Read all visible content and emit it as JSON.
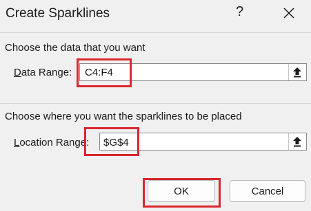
{
  "dialog": {
    "title": "Create Sparklines",
    "help_label": "?"
  },
  "data_section": {
    "heading": "Choose the data that you want",
    "field_label_underlined": "D",
    "field_label_rest": "ata Range:",
    "value": "C4:F4"
  },
  "location_section": {
    "heading": "Choose where you want the sparklines to be placed",
    "field_label_underlined": "L",
    "field_label_rest": "ocation Range:",
    "value": "$G$4"
  },
  "buttons": {
    "ok_label": "OK",
    "cancel_label": "Cancel"
  },
  "colors": {
    "highlight": "#d9262d",
    "dialog_bg": "#f0f0f0"
  }
}
